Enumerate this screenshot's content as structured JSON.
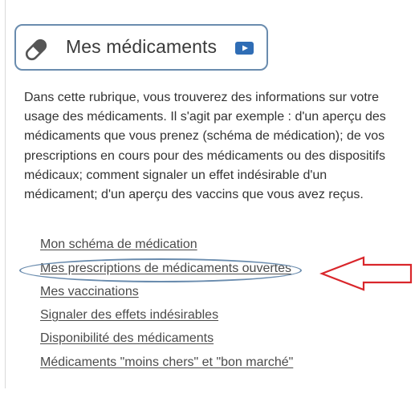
{
  "section": {
    "title": "Mes médicaments",
    "description": "Dans cette rubrique, vous trouverez des informations sur votre usage des médicaments. Il s'agit par exemple : d'un aperçu des médicaments que vous prenez (schéma de médication); de vos prescriptions en cours pour des médicaments ou des dispositifs médicaux; comment signaler un effet indésirable d'un médicament; d'un aperçu des vaccins que vous avez reçus."
  },
  "links": [
    {
      "label": "Mon schéma de médication"
    },
    {
      "label": "Mes prescriptions de médicaments ouvertes"
    },
    {
      "label": "Mes vaccinations"
    },
    {
      "label": "Signaler des effets indésirables"
    },
    {
      "label": "Disponibilité des médicaments"
    },
    {
      "label": "Médicaments \"moins chers\" et \"bon marché\""
    }
  ],
  "annotations": {
    "highlighted_link_index": 1,
    "arrow_color": "#d9262b",
    "outline_color": "#6a8cae"
  },
  "icons": {
    "section_icon": "pill-icon",
    "video": "video-play-icon"
  }
}
